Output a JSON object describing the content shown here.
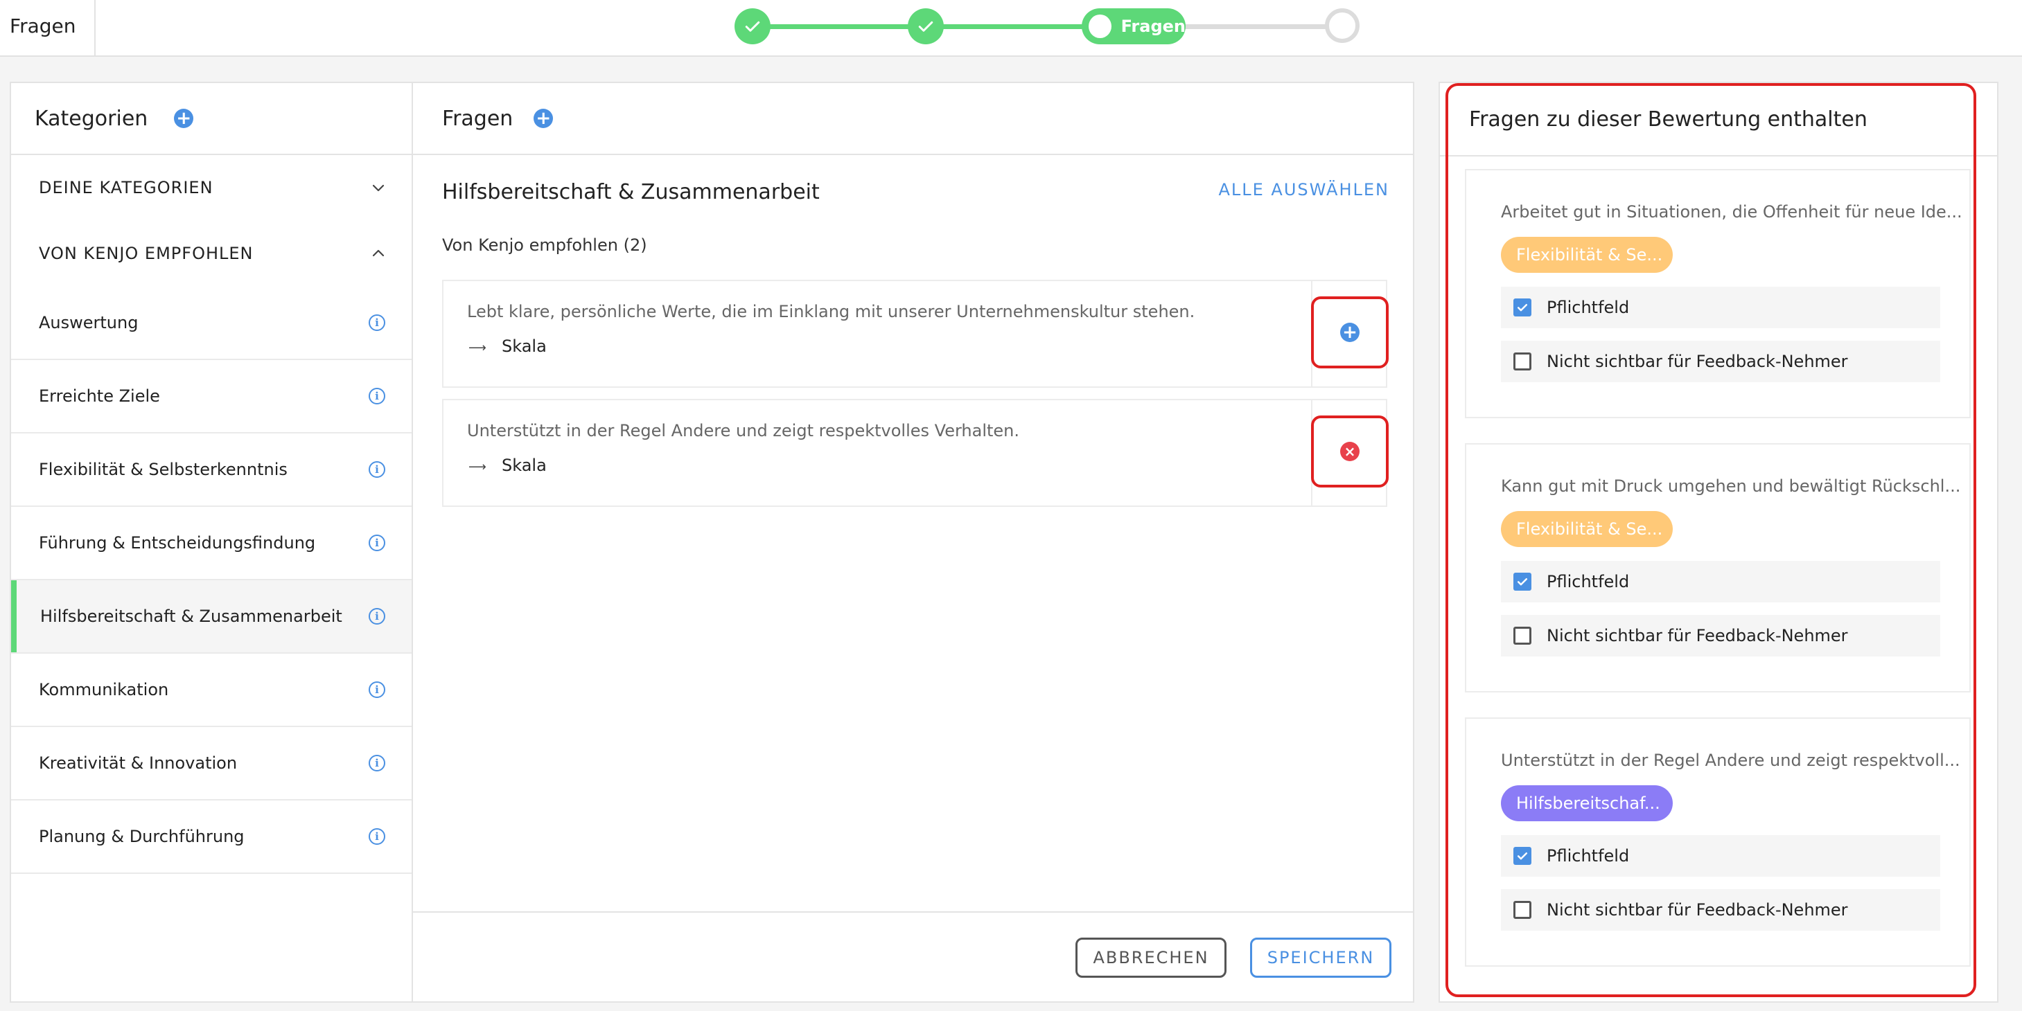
{
  "topbar": {
    "title": "Fragen",
    "steps": [
      {
        "state": "done"
      },
      {
        "state": "done"
      },
      {
        "state": "current",
        "label": "Fragen"
      },
      {
        "state": "pending"
      }
    ]
  },
  "categories": {
    "title": "Kategorien",
    "sections": {
      "own": "DEINE KATEGORIEN",
      "recommended": "VON KENJO EMPFOHLEN"
    },
    "items": [
      {
        "label": "Auswertung"
      },
      {
        "label": "Erreichte Ziele"
      },
      {
        "label": "Flexibilität & Selbsterkenntnis"
      },
      {
        "label": "Führung & Entscheidungsfindung"
      },
      {
        "label": "Hilfsbereitschaft & Zusammenarbeit"
      },
      {
        "label": "Kommunikation"
      },
      {
        "label": "Kreativität & Innovation"
      },
      {
        "label": "Planung & Durchführung"
      }
    ],
    "active_index": 4
  },
  "questions": {
    "title": "Fragen",
    "category_title": "Hilfsbereitschaft & Zusammenarbeit",
    "select_all": "ALLE AUSWÄHLEN",
    "subheading": "Von Kenjo empfohlen (2)",
    "items": [
      {
        "text": "Lebt klare, persönliche Werte, die im Einklang mit unserer Unternehmenskultur stehen.",
        "type": "Skala",
        "action": "add"
      },
      {
        "text": "Unterstützt in der Regel Andere und zeigt respektvolles Verhalten.",
        "type": "Skala",
        "action": "remove"
      }
    ],
    "cancel_label": "ABBRECHEN",
    "save_label": "SPEICHERN"
  },
  "included": {
    "title": "Fragen zu dieser Bewertung enthalten",
    "items": [
      {
        "text": "Arbeitet gut in Situationen, die Offenheit für neue Ide...",
        "tag": "Flexibilität & Se...",
        "tag_color": "#ffc978",
        "required_label": "Pflichtfeld",
        "required": true,
        "hidden_label": "Nicht sichtbar für Feedback-Nehmer",
        "hidden": false
      },
      {
        "text": "Kann gut mit Druck umgehen und bewältigt Rückschl...",
        "tag": "Flexibilität & Se...",
        "tag_color": "#ffc978",
        "required_label": "Pflichtfeld",
        "required": true,
        "hidden_label": "Nicht sichtbar für Feedback-Nehmer",
        "hidden": false
      },
      {
        "text": "Unterstützt in der Regel Andere und zeigt respektvoll...",
        "tag": "Hilfsbereitschaf...",
        "tag_color": "#8b7cf6",
        "required_label": "Pflichtfeld",
        "required": true,
        "hidden_label": "Nicht sichtbar für Feedback-Nehmer",
        "hidden": false
      }
    ]
  },
  "colors": {
    "accent": "#4a90e2",
    "success": "#5dd878",
    "danger": "#e8414b",
    "highlight": "#e02020"
  }
}
